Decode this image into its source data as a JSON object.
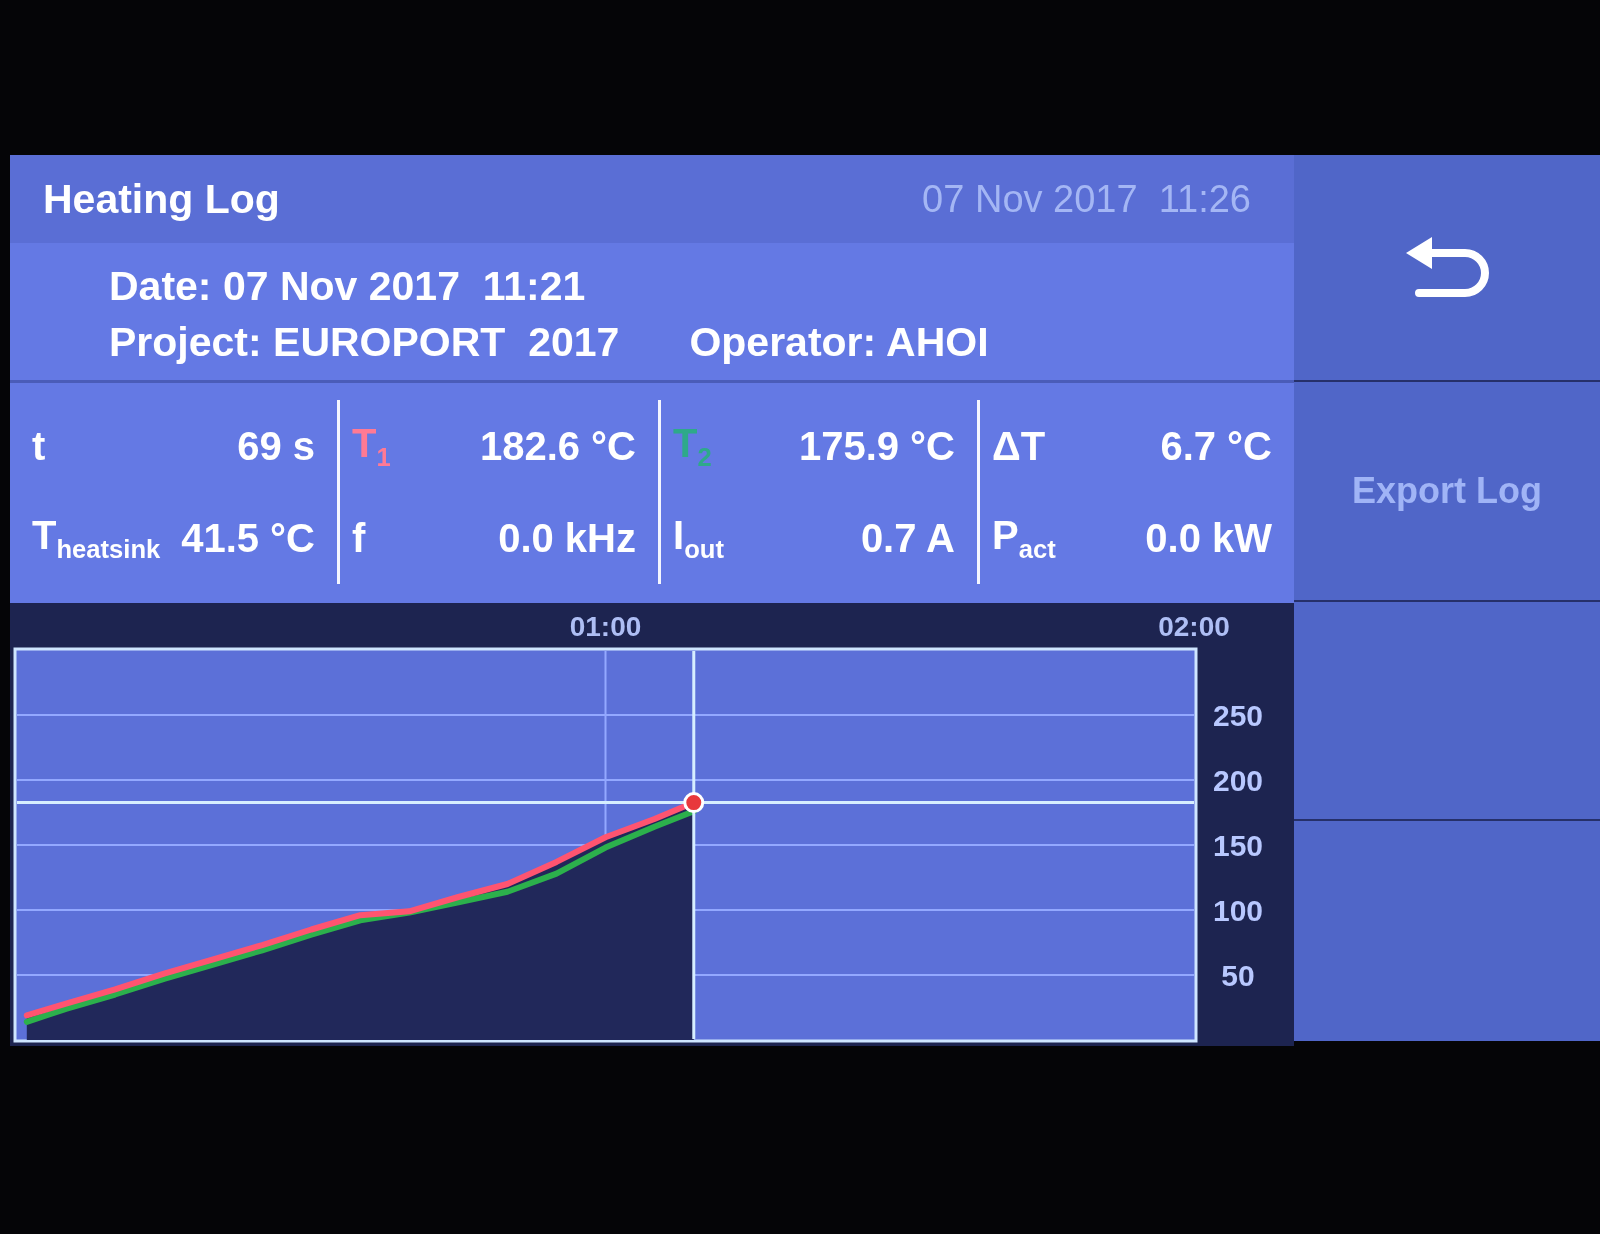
{
  "header": {
    "title": "Heating Log",
    "clock": "07 Nov 2017  11:26"
  },
  "info": {
    "date": "Date: 07 Nov 2017  11:21",
    "project": "Project: EUROPORT  2017",
    "operator": "Operator: AHOI"
  },
  "metrics": [
    {
      "symbol": "t",
      "value": "69 s",
      "color": "#ffffff"
    },
    {
      "symbol": "T$_{1}$",
      "value": "182.6 °C",
      "color": "#ff7a94"
    },
    {
      "symbol": "T$_{2}$",
      "value": "175.9 °C",
      "color": "#2ea98a"
    },
    {
      "symbol": "ΔT",
      "value": "6.7 °C",
      "color": "#ffffff"
    },
    {
      "symbol": "T$_{heatsink}$",
      "value": "41.5 °C",
      "color": "#ffffff"
    },
    {
      "symbol": "f",
      "value": "0.0 kHz",
      "color": "#ffffff"
    },
    {
      "symbol": "I$_{out}$",
      "value": "0.7 A",
      "color": "#ffffff"
    },
    {
      "symbol": "P$_{act}$",
      "value": "0.0 kW",
      "color": "#ffffff"
    }
  ],
  "chart": {
    "chart_data": {
      "type": "line",
      "x": [
        1,
        5,
        10,
        15,
        20,
        25,
        30,
        35,
        40,
        45,
        50,
        55,
        60,
        65,
        69
      ],
      "xlim": [
        0,
        120
      ],
      "ylim": [
        0,
        300
      ],
      "xticks": [
        {
          "value": 60,
          "label": "01:00"
        },
        {
          "value": 120,
          "label": "02:00"
        }
      ],
      "yticks": [
        50,
        100,
        150,
        200,
        250
      ],
      "grid": true,
      "series": [
        {
          "color": "#ff5470",
          "values": [
            19,
            28,
            39,
            51,
            62,
            73,
            85,
            96,
            99,
            110,
            120,
            137,
            156,
            170,
            182.6
          ]
        },
        {
          "color": "#2cb04c",
          "values": [
            14,
            24,
            35,
            47,
            58,
            69,
            81,
            92,
            98,
            106,
            114,
            128,
            148,
            164,
            175.9
          ]
        }
      ],
      "ref_lines": [
        {
          "axis": "x",
          "value": 69
        },
        {
          "axis": "y",
          "value": 182.6
        }
      ]
    }
  },
  "side_buttons": [
    {
      "kind": "back"
    },
    {
      "kind": "text",
      "label": "Export Log"
    },
    {
      "kind": "empty"
    },
    {
      "kind": "empty"
    }
  ]
}
